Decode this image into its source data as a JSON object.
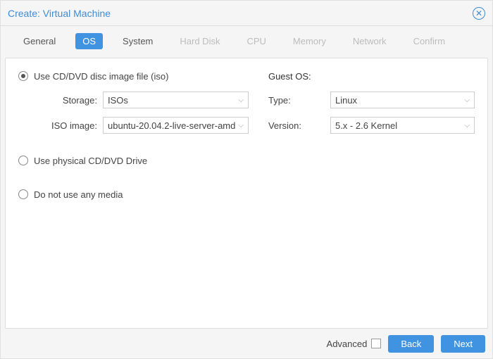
{
  "title": "Create: Virtual Machine",
  "tabs": [
    {
      "label": "General",
      "state": "enabled"
    },
    {
      "label": "OS",
      "state": "active"
    },
    {
      "label": "System",
      "state": "enabled"
    },
    {
      "label": "Hard Disk",
      "state": "disabled"
    },
    {
      "label": "CPU",
      "state": "disabled"
    },
    {
      "label": "Memory",
      "state": "disabled"
    },
    {
      "label": "Network",
      "state": "disabled"
    },
    {
      "label": "Confirm",
      "state": "disabled"
    }
  ],
  "media": {
    "iso_radio_label": "Use CD/DVD disc image file (iso)",
    "physical_radio_label": "Use physical CD/DVD Drive",
    "none_radio_label": "Do not use any media",
    "selected": "iso",
    "storage_label": "Storage:",
    "storage_value": "ISOs",
    "iso_label": "ISO image:",
    "iso_value": "ubuntu-20.04.2-live-server-amd"
  },
  "guest_os": {
    "heading": "Guest OS:",
    "type_label": "Type:",
    "type_value": "Linux",
    "version_label": "Version:",
    "version_value": "5.x - 2.6 Kernel"
  },
  "footer": {
    "advanced_label": "Advanced",
    "advanced_checked": false,
    "back_label": "Back",
    "next_label": "Next"
  }
}
